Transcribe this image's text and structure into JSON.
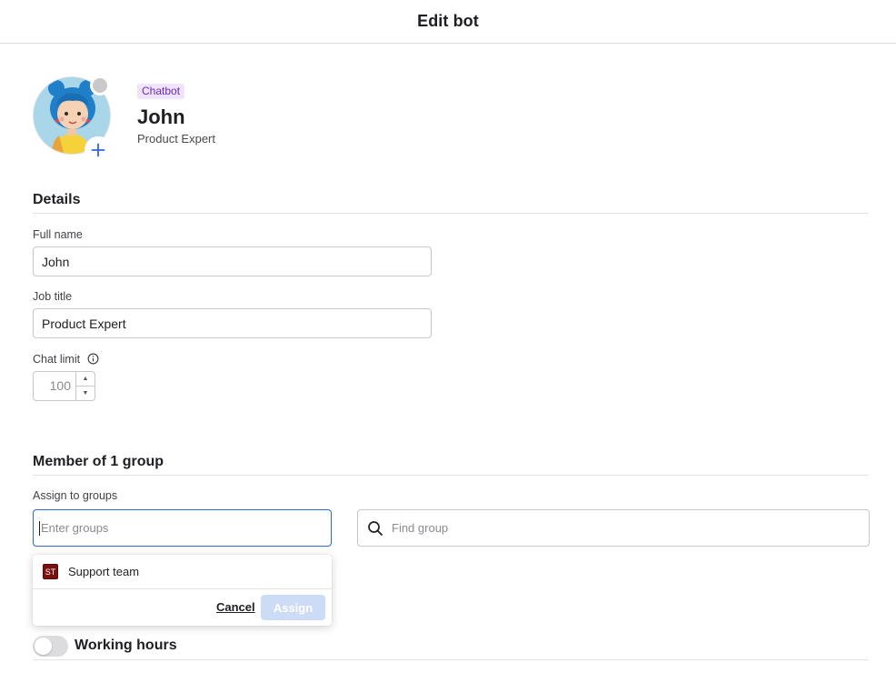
{
  "header": {
    "title": "Edit bot"
  },
  "profile": {
    "badge": "Chatbot",
    "name": "John",
    "role": "Product Expert",
    "status_color": "#c9c9cc"
  },
  "details": {
    "section_title": "Details",
    "full_name": {
      "label": "Full name",
      "value": "John"
    },
    "job_title": {
      "label": "Job title",
      "value": "Product Expert"
    },
    "chat_limit": {
      "label": "Chat limit",
      "value": "100"
    }
  },
  "groups": {
    "section_title": "Member of 1 group",
    "assign_label": "Assign to groups",
    "enter_placeholder": "Enter groups",
    "find_placeholder": "Find group",
    "dropdown": {
      "items": [
        {
          "initials": "ST",
          "label": "Support team",
          "color": "#7a1010"
        }
      ],
      "cancel_label": "Cancel",
      "assign_label": "Assign"
    }
  },
  "working_hours": {
    "title": "Working hours",
    "enabled": false
  },
  "colors": {
    "accent": "#2c66d9",
    "badge_bg": "#efe4fb",
    "badge_text": "#6c2bb6"
  }
}
